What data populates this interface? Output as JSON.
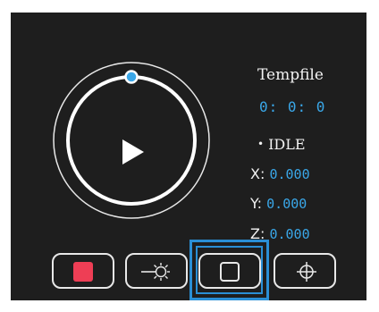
{
  "job": {
    "filename": "Tempfile",
    "timer": "0: 0: 0",
    "status_dot": "•",
    "status": "IDLE"
  },
  "coords": {
    "x_label": "X:",
    "x_value": "0.000",
    "y_label": "Y:",
    "y_value": "0.000",
    "z_label": "Z:",
    "z_value": "0.000"
  },
  "progress": {
    "fraction": 0
  },
  "toolbar": {
    "buttons": [
      {
        "name": "stop",
        "icon": "stop-icon",
        "color": "#ee3e55"
      },
      {
        "name": "laser",
        "icon": "laser-icon"
      },
      {
        "name": "frame",
        "icon": "frame-icon",
        "selected": true
      },
      {
        "name": "target",
        "icon": "crosshair-icon"
      }
    ]
  },
  "colors": {
    "panel_background": "#1e1e1e",
    "accent": "#3aa7e8",
    "stop": "#ee3e55",
    "selection": "#2a8fd6",
    "foreground": "#f2f2f2"
  }
}
